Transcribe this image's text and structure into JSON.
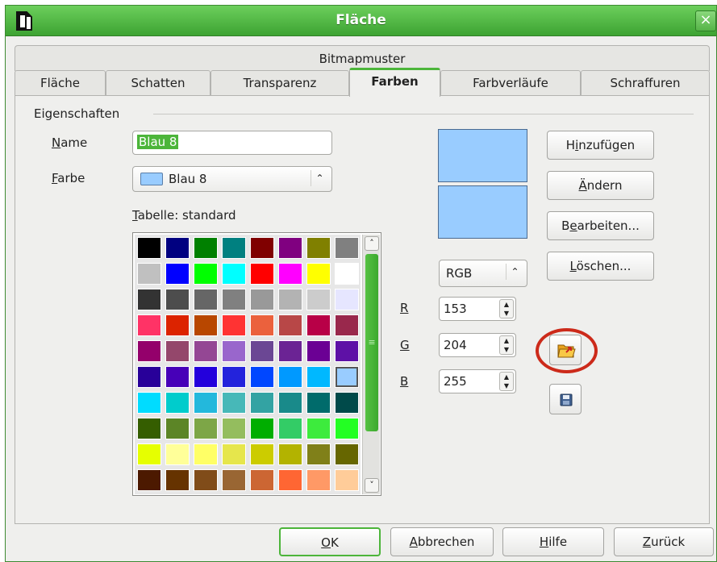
{
  "window": {
    "title": "Fläche",
    "close_glyph": "×"
  },
  "tabs_row1": [
    "Bitmapmuster"
  ],
  "tabs_row2": [
    "Fläche",
    "Schatten",
    "Transparenz",
    "Farben",
    "Farbverläufe",
    "Schraffuren"
  ],
  "active_tab": "Farben",
  "section": {
    "label": "Eigenschaften"
  },
  "name_field": {
    "label_u": "N",
    "label_rest": "ame",
    "value": "Blau 8"
  },
  "color_field": {
    "label_u": "F",
    "label_rest": "arbe",
    "value": "Blau 8",
    "swatch": "#99ccff"
  },
  "table": {
    "label_u": "T",
    "label_rest": "abelle: standard"
  },
  "palette": {
    "rows": [
      [
        "#000000",
        "#000080",
        "#008000",
        "#008080",
        "#800000",
        "#800080",
        "#808000",
        "#808080"
      ],
      [
        "#c0c0c0",
        "#0000ff",
        "#00ff00",
        "#00ffff",
        "#ff0000",
        "#ff00ff",
        "#ffff00",
        "#ffffff"
      ],
      [
        "#333333",
        "#4d4d4d",
        "#666666",
        "#808080",
        "#999999",
        "#b3b3b3",
        "#cccccc",
        "#e6e6ff"
      ],
      [
        "#ff3366",
        "#dc2300",
        "#b84700",
        "#ff3333",
        "#eb613d",
        "#b84747",
        "#b80047",
        "#99284c"
      ],
      [
        "#94006b",
        "#94476b",
        "#944794",
        "#9966cc",
        "#6b4794",
        "#6b2394",
        "#6b0094",
        "#5e11a6"
      ],
      [
        "#280099",
        "#4700b8",
        "#2300dc",
        "#2323dc",
        "#0047ff",
        "#0099ff",
        "#00b8ff",
        "#99ccff"
      ],
      [
        "#00dcff",
        "#00cccc",
        "#23b8dc",
        "#47b8b8",
        "#33a3a3",
        "#198a8a",
        "#006b6b",
        "#004a4a"
      ],
      [
        "#355e00",
        "#5c8526",
        "#7da647",
        "#94bd5e",
        "#00ae00",
        "#33cc66",
        "#3deb3d",
        "#23ff23"
      ],
      [
        "#e6ff00",
        "#ffff99",
        "#ffff66",
        "#e6e64c",
        "#cccc00",
        "#b3b300",
        "#808019",
        "#666600"
      ],
      [
        "#4c1900",
        "#663300",
        "#804c19",
        "#996633",
        "#cc6633",
        "#ff6633",
        "#ff9966",
        "#ffcc99"
      ]
    ],
    "selected_row": 5,
    "selected_col": 7,
    "scroll_up": "˄",
    "scroll_down": "˅",
    "thumb_grip": "≡"
  },
  "preview": {
    "color": "#99ccff"
  },
  "color_model": {
    "value": "RGB"
  },
  "rgb": [
    {
      "label": "R",
      "value": "153"
    },
    {
      "label": "G",
      "value": "204"
    },
    {
      "label": "B",
      "value": "255"
    }
  ],
  "buttons": {
    "add": {
      "pre": "H",
      "u": "i",
      "post": "nzufügen"
    },
    "modify": {
      "pre": "",
      "u": "Ä",
      "post": "ndern"
    },
    "edit": {
      "pre": "B",
      "u": "e",
      "post": "arbeiten..."
    },
    "delete": {
      "pre": "",
      "u": "L",
      "post": "öschen..."
    }
  },
  "footer": {
    "ok": {
      "u": "O",
      "post": "K"
    },
    "cancel": {
      "u": "A",
      "post": "bbrechen"
    },
    "help": {
      "u": "H",
      "post": "ilfe"
    },
    "back": {
      "u": "Z",
      "post": "urück"
    }
  },
  "colors": {
    "accent": "#4cb53a",
    "highlight_ring": "#cc2a1a"
  }
}
